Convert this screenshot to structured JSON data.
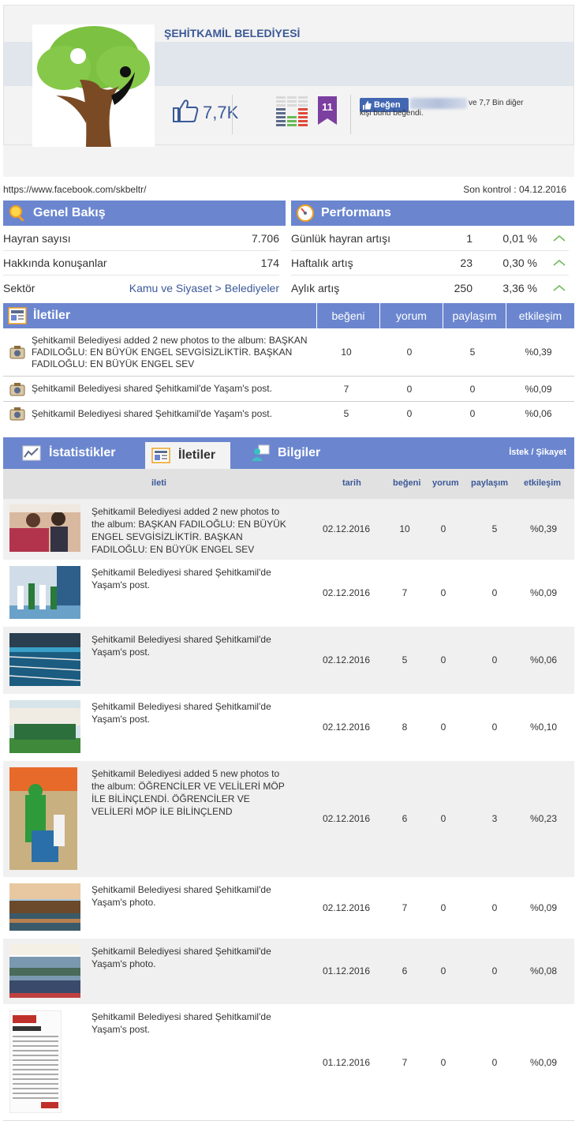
{
  "page": {
    "title": "ŞEHİTKAMİL BELEDİYESİ",
    "fans_short": "7,7K",
    "rank": "11",
    "like_button": "Beğen",
    "like_text": "ve 7,7 Bin diğer",
    "like_text2": "kişi bunu beğendi.",
    "url": "https://www.facebook.com/skbeltr/",
    "last_check": "Son kontrol : 04.12.2016"
  },
  "overview": {
    "title": "Genel Bakış",
    "rows": [
      {
        "label": "Hayran sayısı",
        "value": "7.706"
      },
      {
        "label": "Hakkında konuşanlar",
        "value": "174"
      },
      {
        "label": "Sektör",
        "value": "Kamu ve Siyaset > Belediyeler"
      }
    ]
  },
  "performance": {
    "title": "Performans",
    "rows": [
      {
        "label": "Günlük hayran artışı",
        "count": "1",
        "pct": "0,01 %"
      },
      {
        "label": "Haftalık artış",
        "count": "23",
        "pct": "0,30 %"
      },
      {
        "label": "Aylık artış",
        "count": "250",
        "pct": "3,36 %"
      }
    ]
  },
  "summary": {
    "title": "İletiler",
    "cols": [
      "beğeni",
      "yorum",
      "paylaşım",
      "etkileşim"
    ],
    "rows": [
      {
        "text": "Şehitkamil Belediyesi added 2 new photos to the album: BAŞKAN FADILOĞLU: EN BÜYÜK ENGEL SEVGİSİZLİKTİR. BAŞKAN FADILOĞLU: EN BÜYÜK ENGEL SEV",
        "likes": "10",
        "comments": "0",
        "shares": "5",
        "eng": "%0,39"
      },
      {
        "text": "Şehitkamil Belediyesi shared Şehitkamil'de Yaşam's post.",
        "likes": "7",
        "comments": "0",
        "shares": "0",
        "eng": "%0,09"
      },
      {
        "text": "Şehitkamil Belediyesi shared Şehitkamil'de Yaşam's post.",
        "likes": "5",
        "comments": "0",
        "shares": "0",
        "eng": "%0,06"
      }
    ]
  },
  "tabs": {
    "stats": "İstatistikler",
    "posts": "İletiler",
    "info": "Bilgiler",
    "complaint": "İstek / Şikayet"
  },
  "list": {
    "cols": {
      "post": "ileti",
      "date": "tarih",
      "likes": "beğeni",
      "comments": "yorum",
      "shares": "paylaşım",
      "eng": "etkileşim"
    },
    "rows": [
      {
        "text": "Şehitkamil Belediyesi added 2 new photos to the album: BAŞKAN FADILOĞLU: EN BÜYÜK ENGEL SEVGİSİZLİKTİR. BAŞKAN FADILOĞLU: EN BÜYÜK ENGEL SEV",
        "date": "02.12.2016",
        "likes": "10",
        "comments": "0",
        "shares": "5",
        "eng": "%0,39"
      },
      {
        "text": "Şehitkamil Belediyesi shared Şehitkamil'de Yaşam's post.",
        "date": "02.12.2016",
        "likes": "7",
        "comments": "0",
        "shares": "0",
        "eng": "%0,09"
      },
      {
        "text": "Şehitkamil Belediyesi shared Şehitkamil'de Yaşam's post.",
        "date": "02.12.2016",
        "likes": "5",
        "comments": "0",
        "shares": "0",
        "eng": "%0,06"
      },
      {
        "text": "Şehitkamil Belediyesi shared Şehitkamil'de Yaşam's post.",
        "date": "02.12.2016",
        "likes": "8",
        "comments": "0",
        "shares": "0",
        "eng": "%0,10"
      },
      {
        "text": "Şehitkamil Belediyesi added 5 new photos to the album: ÖĞRENCİLER VE VELİLERİ MÖP İLE BİLİNÇLENDİ. ÖĞRENCİLER VE VELİLERİ MÖP İLE BİLİNÇLEND",
        "date": "02.12.2016",
        "likes": "6",
        "comments": "0",
        "shares": "3",
        "eng": "%0,23"
      },
      {
        "text": "Şehitkamil Belediyesi shared Şehitkamil'de Yaşam's photo.",
        "date": "02.12.2016",
        "likes": "7",
        "comments": "0",
        "shares": "0",
        "eng": "%0,09"
      },
      {
        "text": "Şehitkamil Belediyesi shared Şehitkamil'de Yaşam's photo.",
        "date": "01.12.2016",
        "likes": "6",
        "comments": "0",
        "shares": "0",
        "eng": "%0,08"
      },
      {
        "text": "Şehitkamil Belediyesi shared Şehitkamil'de Yaşam's post.",
        "date": "01.12.2016",
        "likes": "7",
        "comments": "0",
        "shares": "0",
        "eng": "%0,09"
      }
    ]
  },
  "colors": {
    "accent": "#6b86cf",
    "link": "#3b5998",
    "up_arrow": "#6aba54"
  }
}
